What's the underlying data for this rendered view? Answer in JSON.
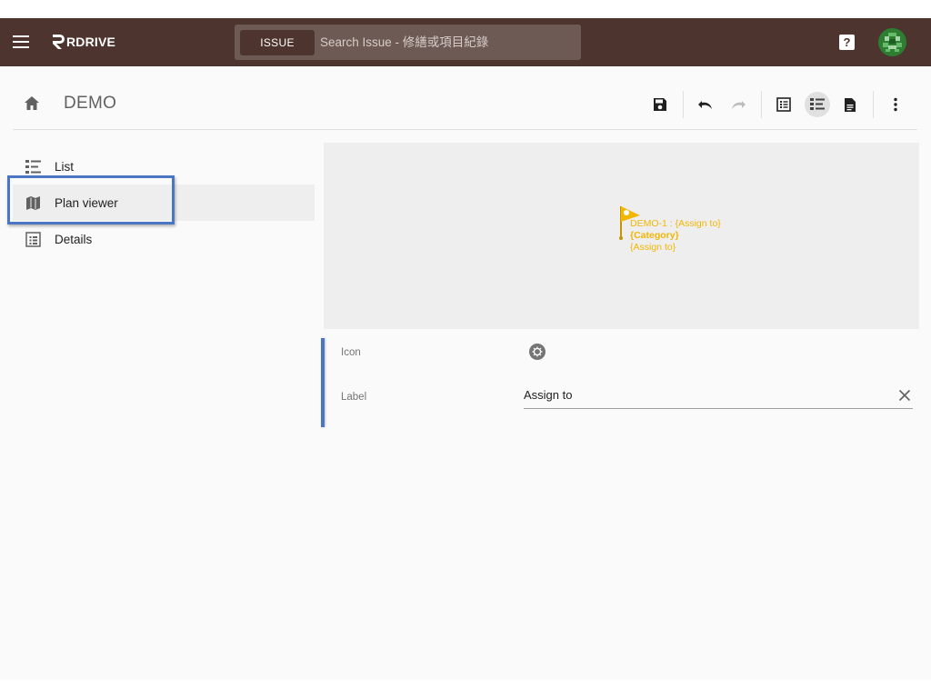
{
  "app": {
    "logo_text": "RDRIVE",
    "menu_icon": "menu-icon",
    "help_icon": "help-icon",
    "help_glyph": "?",
    "avatar_icon": "avatar"
  },
  "search": {
    "chip_label": "ISSUE",
    "placeholder": "Search Issue - 修繕或項目紀錄"
  },
  "header": {
    "title": "DEMO",
    "home_icon": "home-icon",
    "tools": [
      "save-icon",
      "undo-icon",
      "redo-icon",
      "list-view-icon",
      "grouped-view-icon",
      "document-icon",
      "more-vert-icon"
    ],
    "active_tool": "grouped-view-icon"
  },
  "sidebar": {
    "items": [
      {
        "label": "List",
        "icon": "list-icon"
      },
      {
        "label": "Plan viewer",
        "icon": "map-icon",
        "active": true,
        "highlighted": true
      },
      {
        "label": "Details",
        "icon": "details-icon"
      }
    ]
  },
  "plan": {
    "marker_icon": "flag-marker-icon",
    "line1": "DEMO-1 : {Assign to}",
    "line2": "{Category}",
    "line3": "{Assign to}"
  },
  "form": {
    "icon_label": "Icon",
    "icon_value": "gear-icon",
    "label_label": "Label",
    "label_value": "Assign to",
    "clear_icon": "close-icon"
  },
  "colors": {
    "topbar": "#4e342e",
    "search_bg": "#6d5a55",
    "accent_blue": "#4a76c4",
    "marker_yellow": "#f2b705",
    "page_bg": "#fafafa",
    "plan_bg": "#eeeeee"
  }
}
